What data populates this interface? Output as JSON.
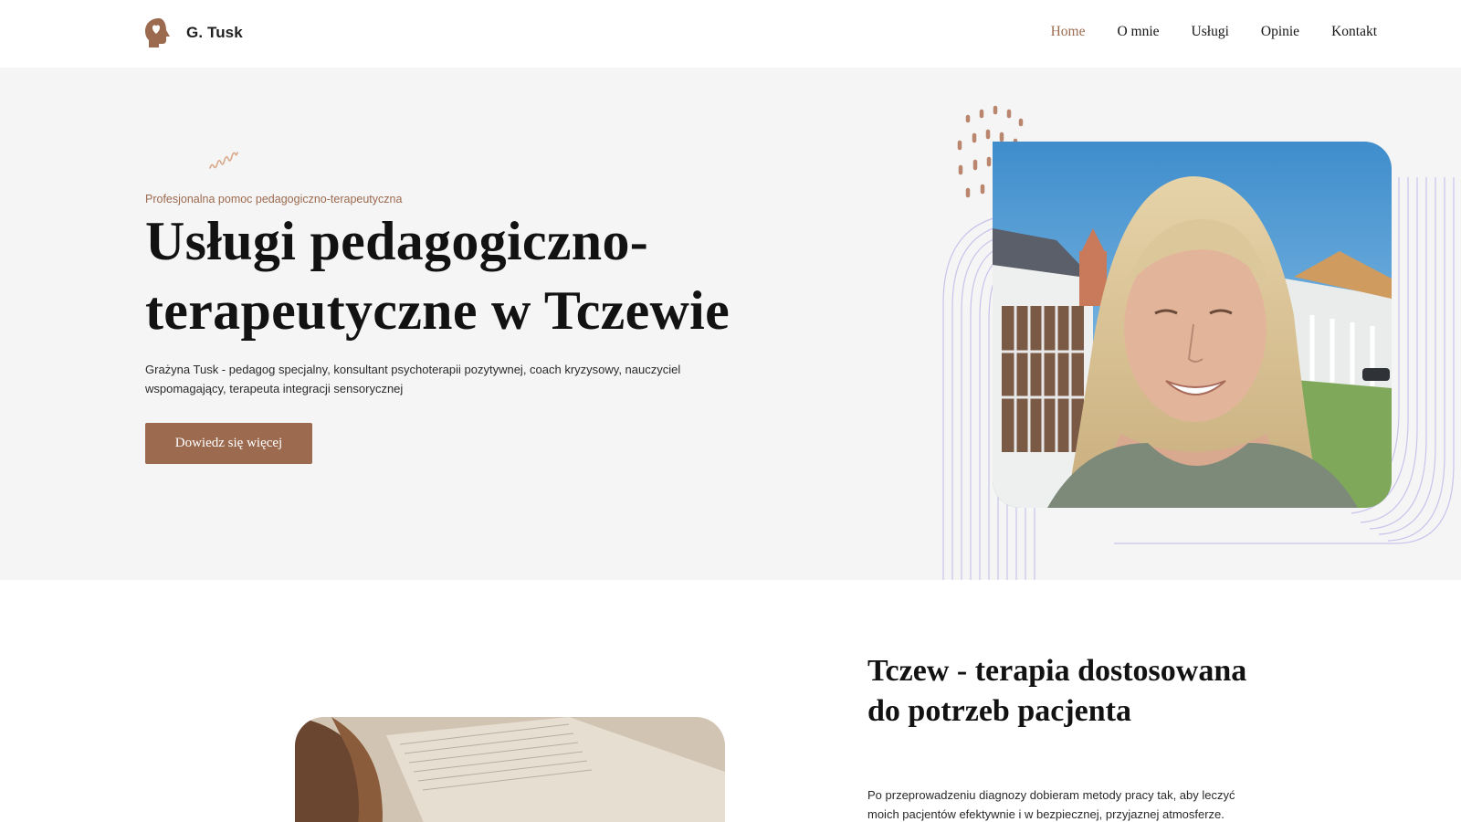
{
  "brand": {
    "name": "G. Tusk",
    "accent_color": "#9c6a4f"
  },
  "nav": {
    "items": [
      {
        "label": "Home",
        "active": true
      },
      {
        "label": "O mnie",
        "active": false
      },
      {
        "label": "Usługi",
        "active": false
      },
      {
        "label": "Opinie",
        "active": false
      },
      {
        "label": "Kontakt",
        "active": false
      }
    ]
  },
  "hero": {
    "eyebrow": "Profesjonalna pomoc pedagogiczno-terapeutyczna",
    "title": "Usługi pedagogiczno-terapeutyczne w Tczewie",
    "description": "Grażyna Tusk - pedagog specjalny, konsultant psychoterapii pozytywnej, coach kryzysowy, nauczyciel wspomagający, terapeuta integracji sensorycznej",
    "cta_label": "Dowiedz się więcej"
  },
  "section2": {
    "title": "Tczew - terapia dostosowana do potrzeb pacjenta",
    "text": "Po przeprowadzeniu diagnozy dobieram metody pracy tak, aby leczyć moich pacjentów efektywnie i w bezpiecznej, przyjaznej atmosferze."
  }
}
